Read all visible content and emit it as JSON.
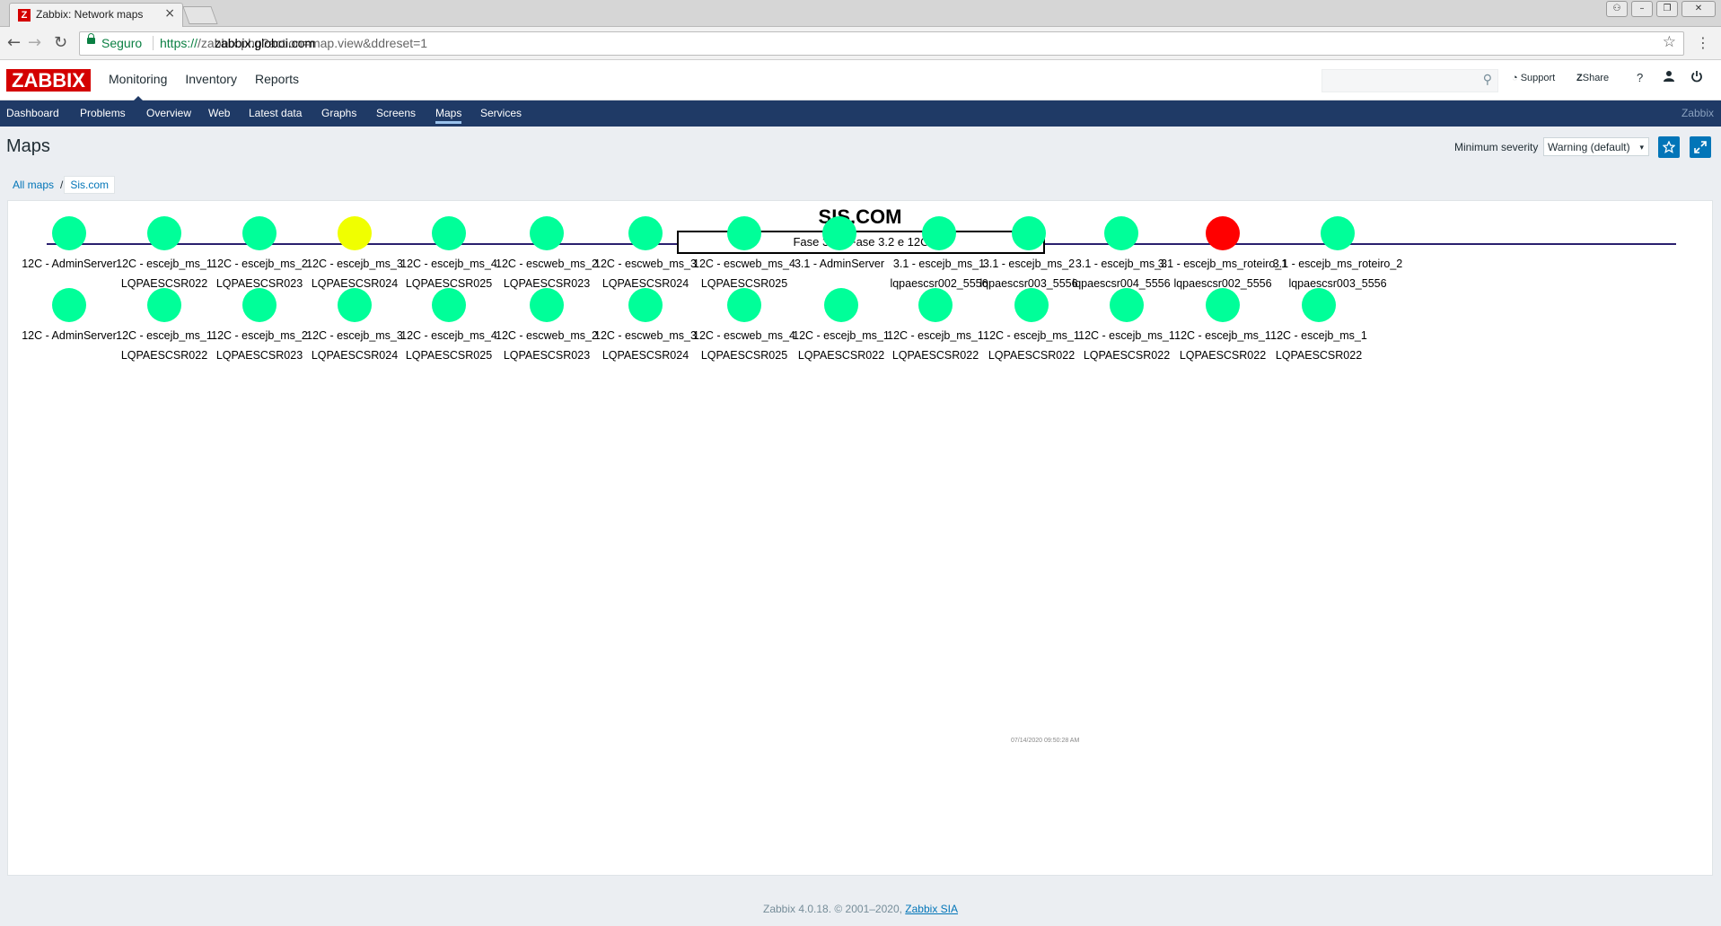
{
  "browser": {
    "tab_title": "Zabbix: Network maps",
    "tab_close": "×",
    "favicon_letter": "Z",
    "secure_label": "Seguro",
    "url_scheme": "https://",
    "url_host": "zabbix.globoi.com",
    "url_path": "/zabbix.php?action=map.view&ddreset=1",
    "back_icon": "←",
    "forward_icon": "→",
    "reload_icon": "↻",
    "star_icon": "☆",
    "menu_icon": "⋮"
  },
  "header": {
    "logo": "ZABBIX",
    "menu": [
      "Monitoring",
      "Inventory",
      "Reports"
    ],
    "support": "Support",
    "share": "Share",
    "help": "?",
    "user_icon": "user-icon",
    "power_icon": "power-icon",
    "search_icon": "⚲"
  },
  "subnav": {
    "items": [
      "Dashboard",
      "Problems",
      "Overview",
      "Web",
      "Latest data",
      "Graphs",
      "Screens",
      "Maps",
      "Services"
    ],
    "active": "Maps",
    "brand": "Zabbix"
  },
  "page": {
    "title": "Maps",
    "severity_label": "Minimum severity",
    "severity_value": "Warning (default)",
    "severity_arrow": "▾"
  },
  "breadcrumb": {
    "all": "All maps",
    "separator": "/",
    "current": "Sis.com"
  },
  "map": {
    "title": "SIS.COM",
    "phase": "Fase 3.1 - Fase 3.2 e 12C",
    "timestamp": "07/14/2020 09:50:28 AM",
    "row1": [
      {
        "l1": "12C - AdminServer",
        "l2": "",
        "status": "ok"
      },
      {
        "l1": "12C - escejb_ms_1",
        "l2": "LQPAESCSR022",
        "status": "ok"
      },
      {
        "l1": "12C - escejb_ms_2",
        "l2": "LQPAESCSR023",
        "status": "ok"
      },
      {
        "l1": "12C - escejb_ms_3",
        "l2": "LQPAESCSR024",
        "status": "warning"
      },
      {
        "l1": "12C - escejb_ms_4",
        "l2": "LQPAESCSR025",
        "status": "ok"
      },
      {
        "l1": "12C - escweb_ms_2",
        "l2": "LQPAESCSR023",
        "status": "ok"
      },
      {
        "l1": "12C - escweb_ms_3",
        "l2": "LQPAESCSR024",
        "status": "ok"
      },
      {
        "l1": "12C - escweb_ms_4",
        "l2": "LQPAESCSR025",
        "status": "ok"
      },
      {
        "l1": "3.1 - AdminServer",
        "l2": "",
        "status": "ok"
      },
      {
        "l1": "3.1 - escejb_ms_1",
        "l2": "lqpaescsr002_5556",
        "status": "ok"
      },
      {
        "l1": "3.1 - escejb_ms_2",
        "l2": "lqpaescsr003_5556",
        "status": "ok"
      },
      {
        "l1": "3.1 - escejb_ms_3",
        "l2": "lqpaescsr004_5556",
        "status": "ok"
      },
      {
        "l1": "3.1 - escejb_ms_roteiro_1",
        "l2": "lqpaescsr002_5556",
        "status": "problem"
      },
      {
        "l1": "3.1 - escejb_ms_roteiro_2",
        "l2": "lqpaescsr003_5556",
        "status": "ok"
      }
    ],
    "row2": [
      {
        "l1": "12C - AdminServer",
        "l2": "",
        "status": "ok"
      },
      {
        "l1": "12C - escejb_ms_1",
        "l2": "LQPAESCSR022",
        "status": "ok"
      },
      {
        "l1": "12C - escejb_ms_2",
        "l2": "LQPAESCSR023",
        "status": "ok"
      },
      {
        "l1": "12C - escejb_ms_3",
        "l2": "LQPAESCSR024",
        "status": "ok"
      },
      {
        "l1": "12C - escejb_ms_4",
        "l2": "LQPAESCSR025",
        "status": "ok"
      },
      {
        "l1": "12C - escweb_ms_2",
        "l2": "LQPAESCSR023",
        "status": "ok"
      },
      {
        "l1": "12C - escweb_ms_3",
        "l2": "LQPAESCSR024",
        "status": "ok"
      },
      {
        "l1": "12C - escweb_ms_4",
        "l2": "LQPAESCSR025",
        "status": "ok"
      },
      {
        "l1": "12C - escejb_ms_1",
        "l2": "LQPAESCSR022",
        "status": "ok"
      },
      {
        "l1": "12C - escejb_ms_1",
        "l2": "LQPAESCSR022",
        "status": "ok"
      },
      {
        "l1": "12C - escejb_ms_1",
        "l2": "LQPAESCSR022",
        "status": "ok"
      },
      {
        "l1": "12C - escejb_ms_1",
        "l2": "LQPAESCSR022",
        "status": "ok"
      },
      {
        "l1": "12C - escejb_ms_1",
        "l2": "LQPAESCSR022",
        "status": "ok"
      },
      {
        "l1": "12C - escejb_ms_1",
        "l2": "LQPAESCSR022",
        "status": "ok"
      }
    ]
  },
  "status_colors": {
    "ok": "#00ff99",
    "warning": "#f0ff00",
    "problem": "#ff0000"
  },
  "footer": {
    "text": "Zabbix 4.0.18. © 2001–2020, ",
    "link": "Zabbix SIA"
  }
}
